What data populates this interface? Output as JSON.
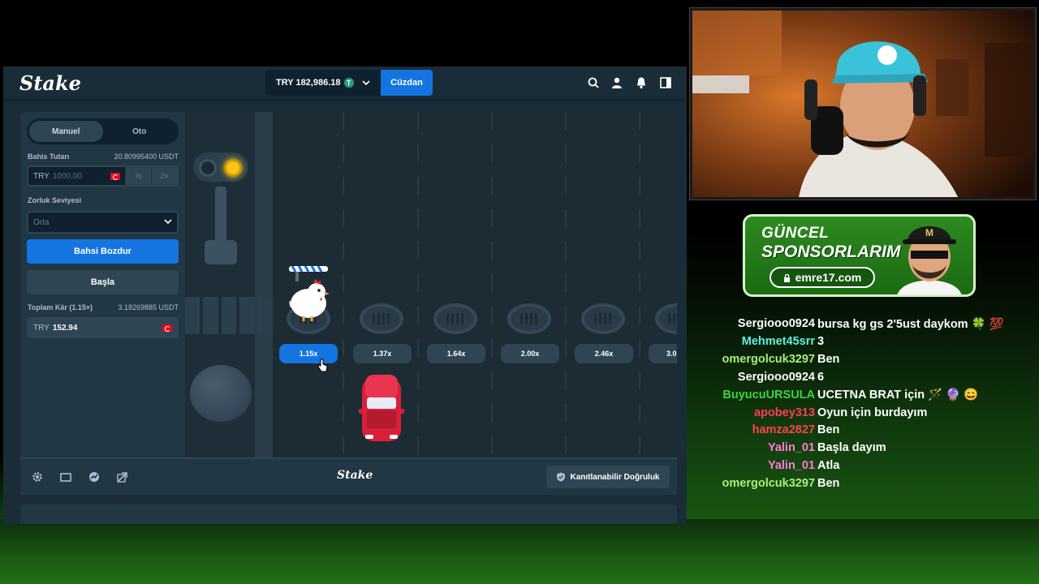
{
  "stake": {
    "logo": "Stake",
    "balance": "TRY 182,986.18",
    "currency_badge": "T",
    "wallet_button": "Cüzdan",
    "tabs": [
      "Manuel",
      "Oto"
    ],
    "bet_label": "Bahis Tutarı",
    "bet_usdt": "20.80995400 USDT",
    "bet_currency": "TRY",
    "bet_value": "1000,00",
    "half_btn": "½",
    "double_btn": "2×",
    "difficulty_label": "Zorluk Seviyesi",
    "difficulty_value": "Orta",
    "cashout_button": "Bahsi Bozdur",
    "start_button": "Başla",
    "profit_label": "Toplam Kâr (1.15×)",
    "profit_usdt": "3.18269885 USDT",
    "profit_currency": "TRY",
    "profit_value": "152.94",
    "multipliers": [
      "1.15x",
      "1.37x",
      "1.64x",
      "2.00x",
      "2.46x",
      "3.0"
    ],
    "active_multiplier_index": 0,
    "footer_logo": "Stake",
    "fair_button": "Kanıtlanabilir Doğruluk",
    "accent": "#1475e1"
  },
  "sponsor": {
    "line1": "GÜNCEL",
    "line2": "SPONSORLARIM",
    "url": "emre17.com"
  },
  "chat": [
    {
      "user": "Sergiooo0924",
      "color": "#ffffff",
      "text": "bursa kg gs 2'5ust daykom 🍀 💯"
    },
    {
      "user": "Mehmet45srr",
      "color": "#5ef2e0",
      "text": "3"
    },
    {
      "user": "omergolcuk3297",
      "color": "#a6f07a",
      "text": "Ben"
    },
    {
      "user": "Sergiooo0924",
      "color": "#ffffff",
      "text": "6"
    },
    {
      "user": "BuyucuURSULA",
      "color": "#3ed43e",
      "text": "UCETNA BRAT için 🪄 🔮 😄"
    },
    {
      "user": "apobey313",
      "color": "#ff3b5c",
      "text": "Oyun için burdayım"
    },
    {
      "user": "hamza2827",
      "color": "#ff4444",
      "text": "Ben"
    },
    {
      "user": "Yalin_01",
      "color": "#ff7ad9",
      "text": "Başla dayım"
    },
    {
      "user": "Yalin_01",
      "color": "#ff7ad9",
      "text": "Atla"
    },
    {
      "user": "omergolcuk3297",
      "color": "#a6f07a",
      "text": "Ben"
    }
  ]
}
